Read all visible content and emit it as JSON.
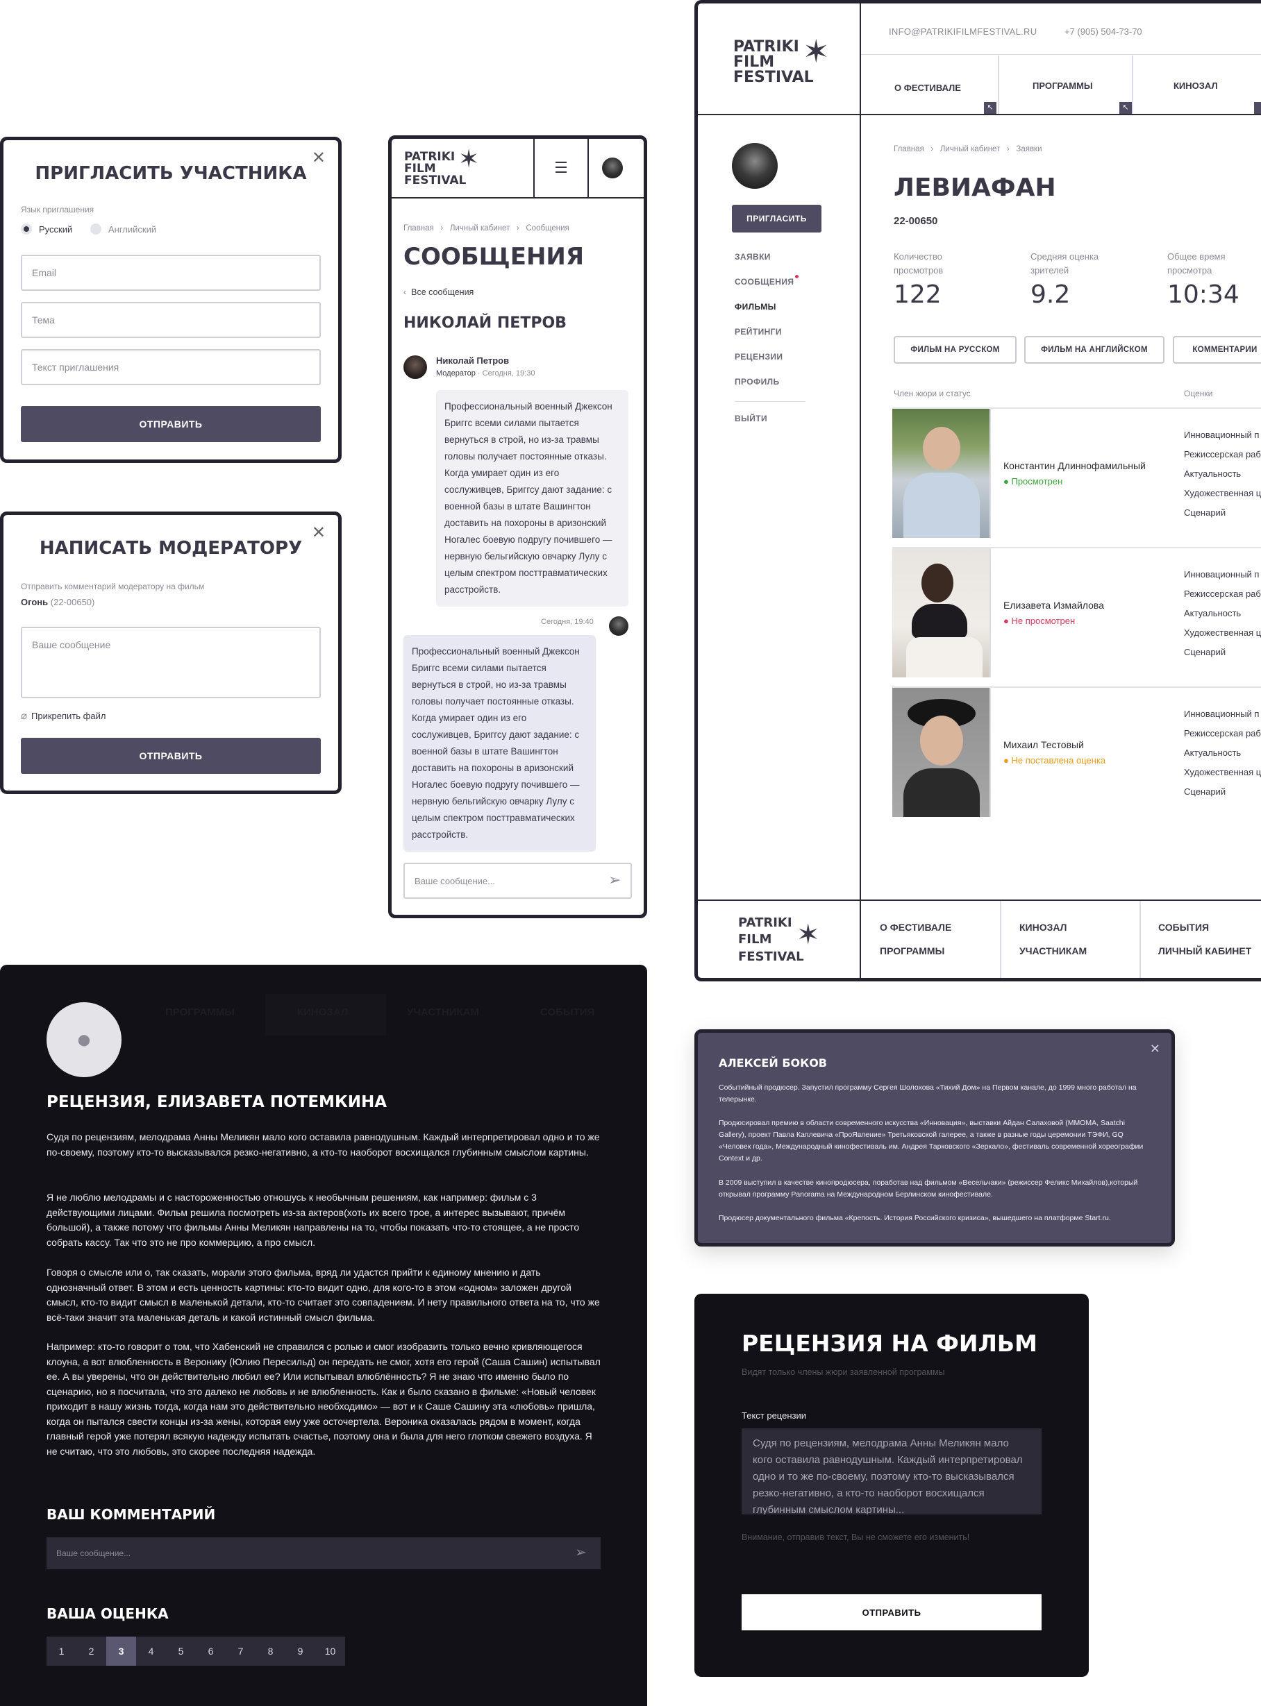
{
  "invite": {
    "title": "ПРИГЛАСИТЬ УЧАСТНИКА",
    "lang_label": "Язык приглашения",
    "lang_ru": "Русский",
    "lang_en": "Английский",
    "email_ph": "Email",
    "subject_ph": "Тема",
    "text_ph": "Текст приглашения",
    "submit": "ОТПРАВИТЬ"
  },
  "moderator": {
    "title": "НАПИСАТЬ МОДЕРАТОРУ",
    "label": "Отправить комментарий модератору на фильм",
    "film": "Огонь",
    "film_code": "(22-00650)",
    "message_ph": "Ваше сообщение",
    "attach": "Прикрепить файл",
    "submit": "ОТПРАВИТЬ"
  },
  "logo": {
    "line1": "PATRIKI",
    "line2": "FILM",
    "line3": "FESTIVAL"
  },
  "mobile": {
    "crumbs": [
      "Главная",
      "Личный кабинет",
      "Сообщения"
    ],
    "title": "СООБЩЕНИЯ",
    "back": "Все сообщения",
    "person": "НИКОЛАЙ ПЕТРОВ",
    "author": "Николай Петров",
    "role": "Модератор",
    "time1": "Сегодня, 19:30",
    "time2": "Сегодня, 19:40",
    "msg1": "Профессиональный военный Джексон Бриггс всеми силами пытается вернуться в строй, но из-за травмы головы получает постоянные отказы. Когда умирает один из его сослуживцев, Бриггсу дают задание: с военной базы в штате Вашингтон доставить на похороны в аризонский Ногалес боевую подругу почившего — нервную бельгийскую овчарку Лулу с целым спектром посттравматических расстройств.",
    "msg2": "Профессиональный военный Джексон Бриггс всеми силами пытается вернуться в строй, но из-за травмы головы получает постоянные отказы. Когда умирает один из его сослуживцев, Бриггсу дают задание: с военной базы в штате Вашингтон доставить на похороны в аризонский Ногалес боевую подругу почившего — нервную бельгийскую овчарку Лулу с целым спектром посттравматических расстройств.",
    "input_ph": "Ваше сообщение..."
  },
  "desktop": {
    "email": "INFO@PATRIKIFILMFESTIVAL.RU",
    "phone": "+7 (905) 504-73-70",
    "nav": [
      "О ФЕСТИВАЛЕ",
      "ПРОГРАММЫ",
      "КИНОЗАЛ"
    ],
    "invite_btn": "ПРИГЛАСИТЬ",
    "side": [
      "ЗАЯВКИ",
      "СООБЩЕНИЯ",
      "ФИЛЬМЫ",
      "РЕЙТИНГИ",
      "РЕЦЕНЗИИ",
      "ПРОФИЛЬ",
      "ВЫЙТИ"
    ],
    "crumbs": [
      "Главная",
      "Личный кабинет",
      "Заявки"
    ],
    "film_title": "ЛЕВИАФАН",
    "film_code": "22-00650",
    "stats": [
      {
        "label": "Количество просмотров",
        "value": "122"
      },
      {
        "label": "Средняя оценка зрителей",
        "value": "9.2"
      },
      {
        "label": "Общее время просмотра",
        "value": "10:34"
      }
    ],
    "tabs": [
      "ФИЛЬМ НА РУССКОМ",
      "ФИЛЬМ НА АНГЛИЙСКОМ",
      "КОММЕНТАРИИ"
    ],
    "jury_header": "Член жюри и статус",
    "scores_header": "Оценки",
    "jury": [
      {
        "name": "Константин Длиннофамильный",
        "status": "Просмотрен",
        "color": "#3aa43a"
      },
      {
        "name": "Елизавета Измайлова",
        "status": "Не просмотрен",
        "color": "#d63a5a"
      },
      {
        "name": "Михаил Тестовый",
        "status": "Не поставлена оценка",
        "color": "#e89a1a"
      }
    ],
    "criteria": [
      "Инновационный п",
      "Режиссерская раб",
      "Актуальность",
      "Художественная ц",
      "Сценарий"
    ],
    "footer": {
      "col1": [
        "О ФЕСТИВАЛЕ",
        "ПРОГРАММЫ"
      ],
      "col2": [
        "КИНОЗАЛ",
        "УЧАСТНИКАМ"
      ],
      "col3": [
        "СОБЫТИЯ",
        "ЛИЧНЫЙ КАБИНЕТ"
      ]
    }
  },
  "review": {
    "title": "РЕЦЕНЗИЯ, ЕЛИЗАВЕТА ПОТЕМКИНА",
    "p1": "Судя по рецензиям, мелодрама Анны Меликян мало кого оставила равнодушным. Каждый интерпретировал одно и то же по-своему, поэтому кто-то высказывался резко-негативно, а кто-то наоборот восхищался глубинным смыслом картины.",
    "p2": "Я не люблю мелодрамы и с настороженностью отношусь к необычным решениям, как например: фильм с 3 действующими лицами. Фильм решила посмотреть из-за актеров(хоть их всего трое, а интерес вызывают, причём большой), а также потому что фильмы Анны Меликян направлены на то, чтобы показать что-то стоящее, а не просто собрать кассу. Так что это не про коммерцию, а про смысл.",
    "p3": "Говоря о смысле или о, так сказать, морали этого фильма, вряд ли удастся прийти к единому мнению и дать однозначный ответ. В этом и есть ценность картины: кто-то видит одно, для кого-то в этом «одном» заложен другой смысл, кто-то видит смысл в маленькой детали, кто-то считает это совпадением. И нету правильного ответа на то, что же всё-таки значит эта маленькая деталь и какой истинный смысл фильма.",
    "p4": "Например: кто-то говорит о том, что Хабенский не справился с ролью и смог изобразить только вечно кривляющегося клоуна, а вот влюбленность в Веронику (Юлию Пересильд) он передать не смог, хотя его герой (Саша Сашин) испытывал ее. А вы уверены, что он действительно любил ее? Или испытывал влюблённость? Я не знаю что именно было по сценарию, но я посчитала, что это далеко не любовь и не влюбленность. Как и было сказано в фильме: «Новый человек приходит в нашу жизнь тогда, когда нам это действительно необходимо» — вот и к Саше Сашину эта «любовь» пришла, когда он пытался свести концы из-за жены, которая ему уже осточертела. Вероника оказалась рядом в момент, когда главный герой уже потерял всякую надежду испытать счастье, поэтому она и была для него глотком свежего воздуха. Я не считаю, что это любовь, это скорее последняя надежда.",
    "comment_title": "ВАШ КОММЕНТАРИЙ",
    "comment_ph": "Ваше сообщение...",
    "score_title": "ВАША ОЦЕНКА",
    "scores": [
      "1",
      "2",
      "3",
      "4",
      "5",
      "6",
      "7",
      "8",
      "9",
      "10"
    ],
    "selected_score": "3",
    "bg_tabs": [
      "ПРОГРАММЫ",
      "КИНОЗАЛ",
      "УЧАСТНИКАМ",
      "СОБЫТИЯ"
    ]
  },
  "bio": {
    "name": "АЛЕКСЕЙ БОКОВ",
    "p1": "Событийный продюсер. Запустил программу Сергея Шолохова «Тихий Дом» на Первом канале, до 1999 много работал на телерынке.",
    "p2": "Продюсировал премию в области современного искусства «Инновация», выставки Айдан Салаховой (ММОМА, Saatchi Gallery), проект Павла Каплевича «ПроЯвление» Третьяковской галерее, а также в разные годы церемонии ТЭФИ, GQ «Человек года», Международный кинофестиваль им. Андрея Тарковского «Зеркало», фестиваль современной хореографии Context и др.",
    "p3": "В 2009 выступил в качестве кинопродюсера, поработав над фильмом «Весельчаки» (режиссер Феликс Михайлов),который открывал программу Panorama на Международном Берлинском кинофестивале.",
    "p4": "Продюсер документального фильма «Крепость. История Российского кризиса», вышедшего на платформе Start.ru."
  },
  "filmreview": {
    "title": "РЕЦЕНЗИЯ НА ФИЛЬМ",
    "subtitle": "Видят только члены жюри заявленной программы",
    "label": "Текст рецензии",
    "text": "Судя по рецензиям, мелодрама Анны Меликян мало кого оставила равнодушным. Каждый интерпретировал одно и то же по-своему, поэтому кто-то высказывался резко-негативно, а кто-то наоборот восхищался глубинным смыслом картины...",
    "warning": "Внимание, отправив текст, Вы не сможете его изменить!",
    "submit": "ОТПРАВИТЬ"
  }
}
